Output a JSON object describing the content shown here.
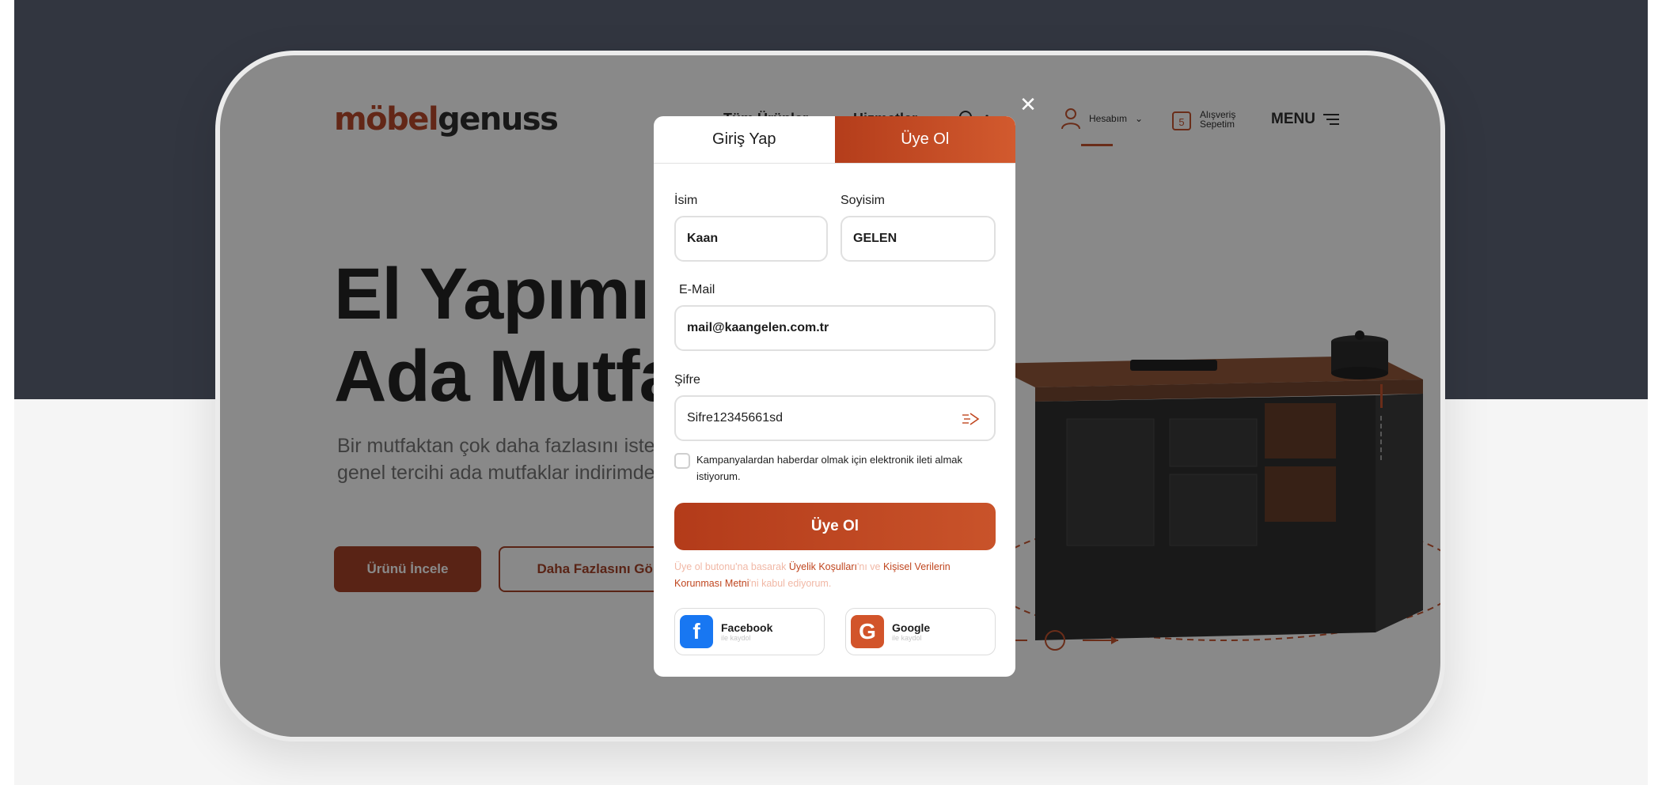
{
  "site": {
    "logo_part1": "möbel",
    "logo_part2": "genuss",
    "nav": [
      "Tüm Ürünler",
      "Hizmetler"
    ],
    "search_label": "Ara",
    "account_label": "Hesabım",
    "cart_line1": "Alışveriş",
    "cart_line2": "Sepetim",
    "menu_label": "MENU"
  },
  "hero": {
    "title_line1": "El Yapımı",
    "title_line2": "Ada Mutfak",
    "subtitle_line1": "Bir mutfaktan çok daha fazlasını isteyenler için",
    "subtitle_line2": "genel tercihi ada mutfaklar indirimde",
    "primary_button": "Ürünü İncele",
    "secondary_button": "Daha Fazlasını Gör"
  },
  "modal": {
    "tabs": [
      {
        "label": "Giriş Yap",
        "active": false
      },
      {
        "label": "Üye Ol",
        "active": true
      }
    ],
    "first_name_label": "İsim",
    "first_name_value": "Kaan",
    "last_name_label": "Soyisim",
    "last_name_value": "GELEN",
    "email_label": "E-Mail",
    "email_value": "mail@kaangelen.com.tr",
    "password_label": "Şifre",
    "password_value": "Sifre12345661sd",
    "checkbox_text": "Kampanyalardan haberdar olmak için elektronik ileti almak istiyorum.",
    "submit_label": "Üye Ol",
    "terms_pre": "Üye ol butonu'na basarak ",
    "terms_link1": "Üyelik Koşulları",
    "terms_mid": "'nı ve ",
    "terms_link2": "Kişisel Verilerin Korunması Metni",
    "terms_post": "'ni kabul ediyorum.",
    "facebook_label": "Facebook",
    "facebook_sub": "ile kaydol",
    "google_label": "Google",
    "google_sub": "ile kaydol"
  },
  "colors": {
    "accent": "#c0461f",
    "accent_dark": "#9e3316",
    "dark_bg": "#323640",
    "facebook": "#1877f2",
    "google": "#d2542a"
  }
}
